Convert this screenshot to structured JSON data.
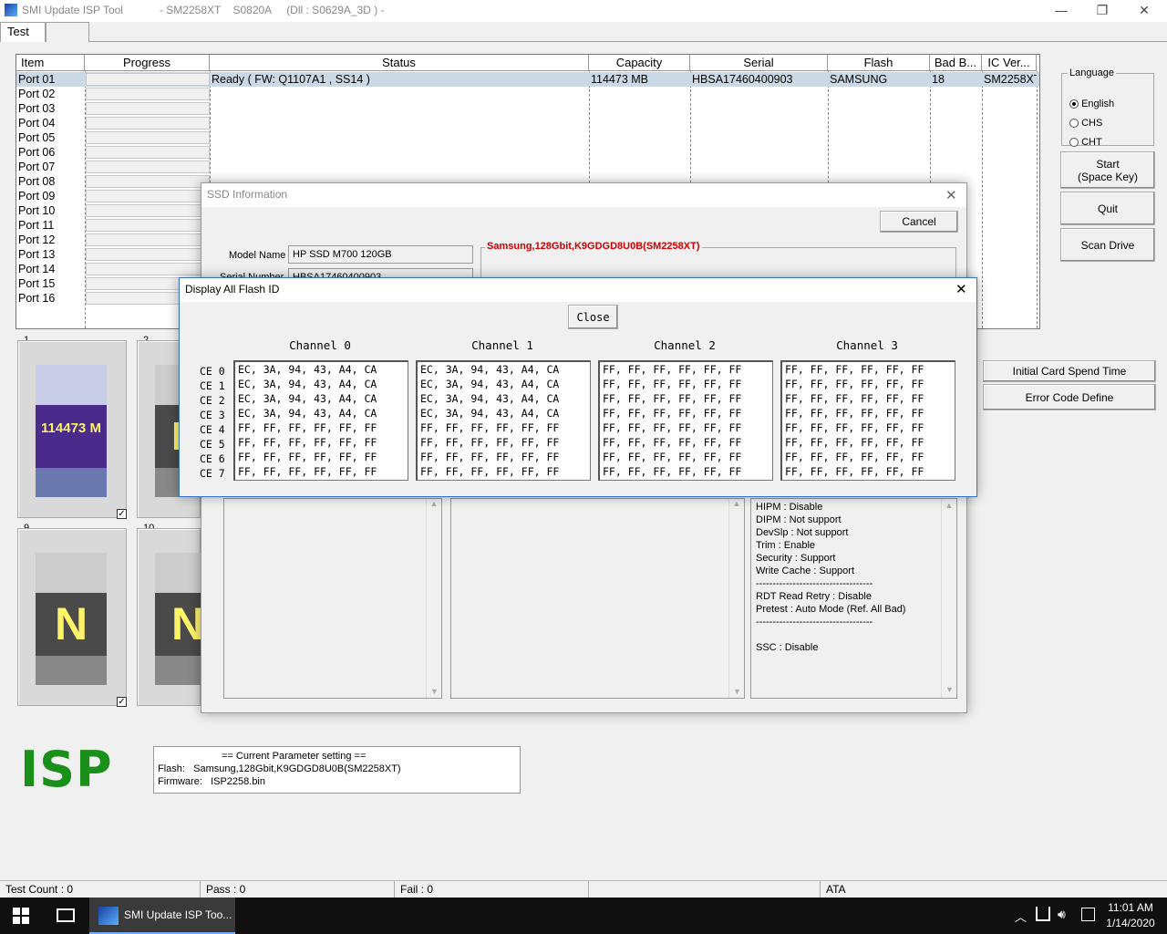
{
  "window": {
    "app_name": "SMI Update ISP Tool",
    "controller": "- SM2258XT",
    "fw_code": "S0820A",
    "dll": "(Dll : S0629A_3D ) -",
    "min": "—",
    "max": "❐",
    "close": "✕"
  },
  "tabs": [
    "Test",
    ""
  ],
  "table": {
    "headers": [
      "Item",
      "Progress",
      "Status",
      "Capacity",
      "Serial",
      "Flash",
      "Bad B...",
      "IC Ver..."
    ],
    "ports": [
      "Port 01",
      "Port 02",
      "Port 03",
      "Port 04",
      "Port 05",
      "Port 06",
      "Port 07",
      "Port 08",
      "Port 09",
      "Port 10",
      "Port 11",
      "Port 12",
      "Port 13",
      "Port 14",
      "Port 15",
      "Port 16"
    ],
    "row1": {
      "status": "Ready ( FW: Q1107A1 ,  SS14 )",
      "capacity": "114473 MB",
      "serial": "HBSA17460400903",
      "flash": "SAMSUNG",
      "bad": "18",
      "ic": "SM2258XT"
    }
  },
  "language": {
    "legend": "Language",
    "options": [
      "English",
      "CHS",
      "CHT"
    ],
    "selected": "English"
  },
  "buttons": {
    "start_line1": "Start",
    "start_line2": "(Space Key)",
    "quit": "Quit",
    "scan": "Scan Drive",
    "initial_card": "Initial Card Spend Time",
    "error_code": "Error Code Define"
  },
  "thumbs": [
    {
      "num": "1",
      "label": "114473 M",
      "checked": true
    },
    {
      "num": "2",
      "label": "N",
      "checked": false
    },
    {
      "num": "9",
      "label": "N",
      "checked": true
    },
    {
      "num": "10",
      "label": "N",
      "checked": false
    }
  ],
  "isp_logo": "ISP",
  "params": {
    "header": "== Current Parameter setting ==",
    "flash_label": "Flash:",
    "flash_value": "Samsung,128Gbit,K9GDGD8U0B(SM2258XT)",
    "fw_label": "Firmware:",
    "fw_value": "ISP2258.bin"
  },
  "statusbar": {
    "test_count": "Test Count : 0",
    "pass": "Pass : 0",
    "fail": "Fail : 0",
    "empty": "",
    "mode": "ATA"
  },
  "taskbar": {
    "app_label": "SMI Update ISP Too...",
    "time": "11:01 AM",
    "date": "1/14/2020"
  },
  "ssd_info": {
    "title": "SSD Information",
    "cancel": "Cancel",
    "model_label": "Model Name",
    "model_value": "HP SSD M700 120GB",
    "serial_label": "Serial Number",
    "serial_value": "HBSA17460400903",
    "flash_title": "Samsung,128Gbit,K9GDGD8U0B(SM2258XT)",
    "features": [
      "HIPM : Disable",
      "DIPM : Not support",
      "DevSlp : Not support",
      "Trim : Enable",
      "Security : Support",
      "Write Cache : Support",
      "-----------------------------------",
      "RDT Read Retry : Disable",
      "Pretest : Auto Mode (Ref. All Bad)",
      "-----------------------------------",
      "",
      "SSC : Disable"
    ]
  },
  "flash_dialog": {
    "title": "Display All Flash ID",
    "close": "Close",
    "channels": [
      "Channel 0",
      "Channel 1",
      "Channel 2",
      "Channel 3"
    ],
    "ce_labels": [
      "CE 0",
      "CE 1",
      "CE 2",
      "CE 3",
      "CE 4",
      "CE 5",
      "CE 6",
      "CE 7"
    ],
    "data": [
      [
        "EC, 3A, 94, 43, A4, CA",
        "EC, 3A, 94, 43, A4, CA",
        "EC, 3A, 94, 43, A4, CA",
        "EC, 3A, 94, 43, A4, CA",
        "FF, FF, FF, FF, FF, FF",
        "FF, FF, FF, FF, FF, FF",
        "FF, FF, FF, FF, FF, FF",
        "FF, FF, FF, FF, FF, FF"
      ],
      [
        "EC, 3A, 94, 43, A4, CA",
        "EC, 3A, 94, 43, A4, CA",
        "EC, 3A, 94, 43, A4, CA",
        "EC, 3A, 94, 43, A4, CA",
        "FF, FF, FF, FF, FF, FF",
        "FF, FF, FF, FF, FF, FF",
        "FF, FF, FF, FF, FF, FF",
        "FF, FF, FF, FF, FF, FF"
      ],
      [
        "FF, FF, FF, FF, FF, FF",
        "FF, FF, FF, FF, FF, FF",
        "FF, FF, FF, FF, FF, FF",
        "FF, FF, FF, FF, FF, FF",
        "FF, FF, FF, FF, FF, FF",
        "FF, FF, FF, FF, FF, FF",
        "FF, FF, FF, FF, FF, FF",
        "FF, FF, FF, FF, FF, FF"
      ],
      [
        "FF, FF, FF, FF, FF, FF",
        "FF, FF, FF, FF, FF, FF",
        "FF, FF, FF, FF, FF, FF",
        "FF, FF, FF, FF, FF, FF",
        "FF, FF, FF, FF, FF, FF",
        "FF, FF, FF, FF, FF, FF",
        "FF, FF, FF, FF, FF, FF",
        "FF, FF, FF, FF, FF, FF"
      ]
    ]
  },
  "colors": {
    "selected_row": "#cbd9e6",
    "isp_green": "#1a8f1a",
    "flash_title_red": "#cc0000",
    "thumb_purple": "#4a2a8a"
  }
}
